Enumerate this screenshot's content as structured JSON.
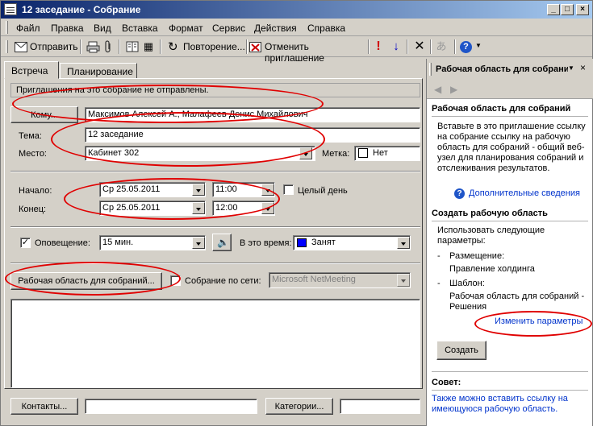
{
  "window": {
    "title": "12 заседание - Собрание"
  },
  "menu": [
    "Файл",
    "Правка",
    "Вид",
    "Вставка",
    "Формат",
    "Сервис",
    "Действия",
    "Справка"
  ],
  "toolbar": {
    "send": "Отправить",
    "recurrence": "Повторение...",
    "cancel_invitation": "Отменить приглашение"
  },
  "tabs": {
    "meeting": "Встреча",
    "planning": "Планирование"
  },
  "info_bar": "Приглашения на это собрание не отправлены.",
  "form": {
    "to_button": "Кому...",
    "to_value": "Максимов Алексей А.; Малафеев Денис Михайлович",
    "subject_label": "Тема:",
    "subject_value": "12 заседание",
    "location_label": "Место:",
    "location_value": "Кабинет 302",
    "label_label": "Метка:",
    "label_value": "Нет",
    "start_label": "Начало:",
    "start_date": "Ср 25.05.2011",
    "start_time": "11:00",
    "all_day": "Целый день",
    "end_label": "Конец:",
    "end_date": "Ср 25.05.2011",
    "end_time": "12:00",
    "reminder_label": "Оповещение:",
    "reminder_value": "15 мин.",
    "show_as_label": "В это время:",
    "show_as_value": "Занят",
    "workspace_button": "Рабочая область для собраний...",
    "online_meeting_label": "Собрание по сети:",
    "online_meeting_value": "Microsoft NetMeeting",
    "contacts_button": "Контакты...",
    "categories_button": "Категории..."
  },
  "colors": {
    "busy": "#0000ff",
    "annotation": "#e00000",
    "link": "#0033cc"
  },
  "pane": {
    "title": "Рабочая область для собраний",
    "section1_title": "Рабочая область для собраний",
    "section1_text": "Вставьте в это приглашение ссылку на собрание ссылку на рабочую область для собраний - общий веб-узел для планирования собраний и отслеживания результатов.",
    "more_info": "Дополнительные сведения",
    "section2_title": "Создать рабочую область",
    "section2_intro": "Использовать следующие параметры:",
    "location_label": "Размещение:",
    "location_value": "Правление холдинга",
    "template_label": "Шаблон:",
    "template_value": "Рабочая область для собраний - Решения",
    "change_params": "Изменить параметры",
    "create_button": "Создать",
    "tip_title": "Совет:",
    "tip_text": "Также можно вставить ссылку на имеющуюся рабочую область."
  }
}
